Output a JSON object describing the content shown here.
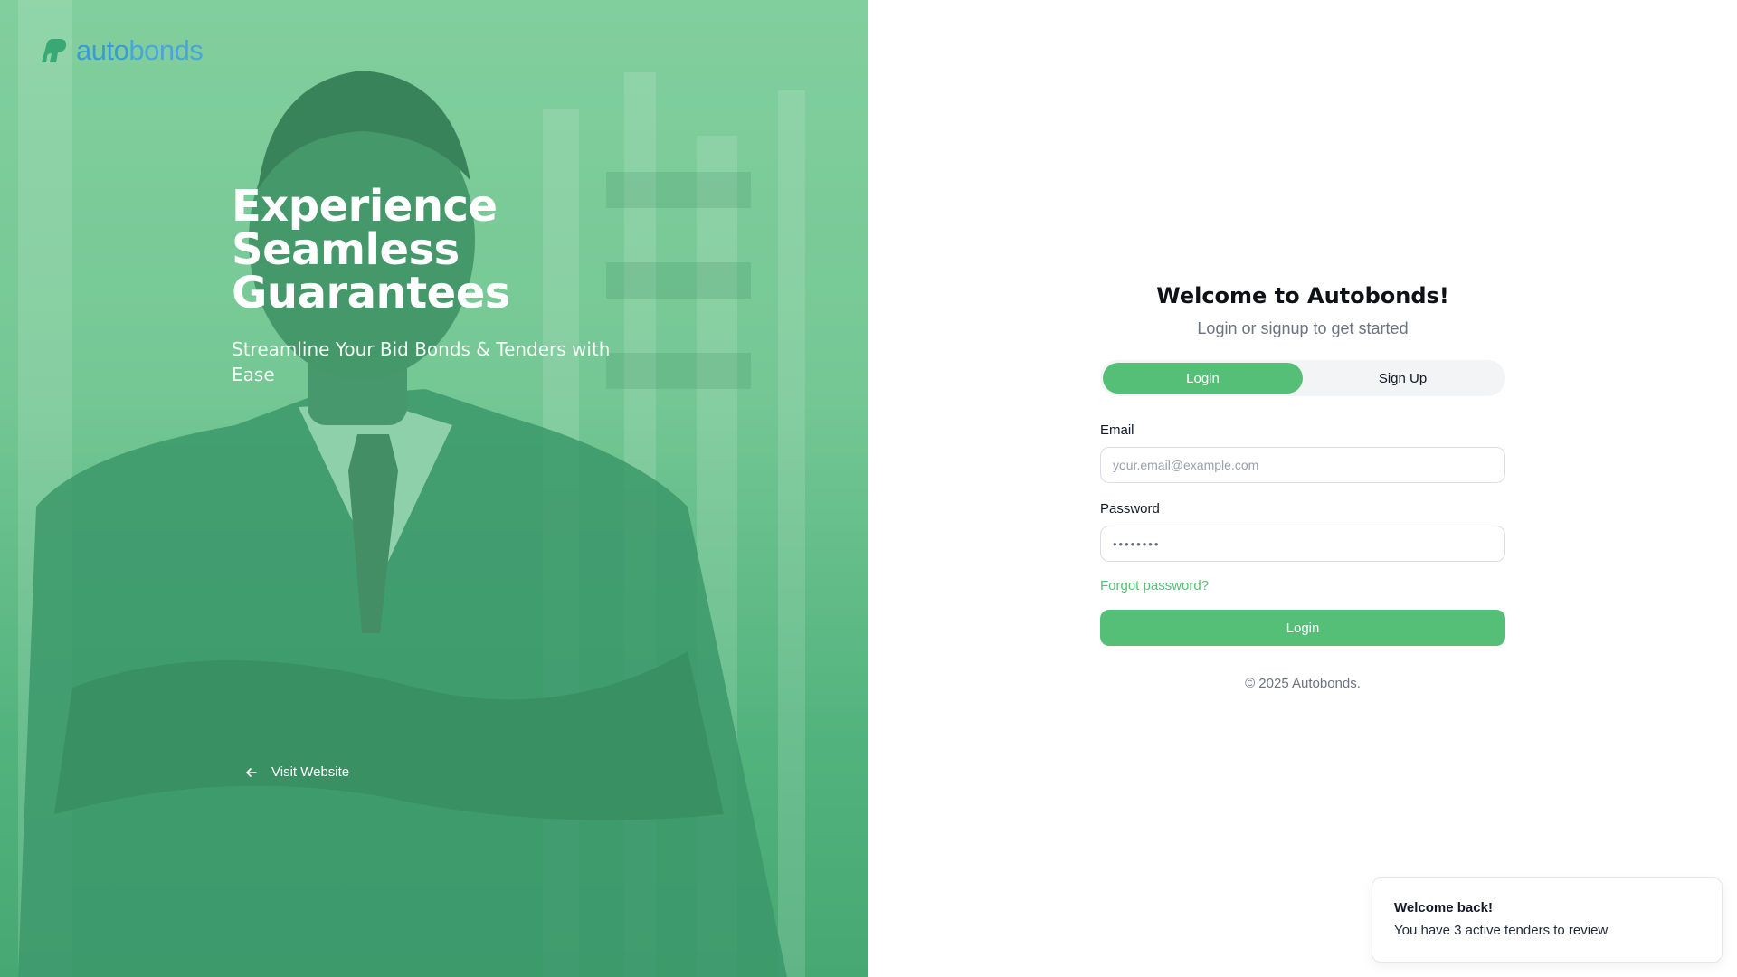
{
  "brand": {
    "logo_text_auto": "auto",
    "logo_text_bonds": "bonds",
    "primary_color": "#55bf77",
    "logo_color": "#3a9bd6"
  },
  "hero": {
    "headline_line1": "Experience",
    "headline_line2": "Seamless",
    "headline_line3": "Guarantees",
    "subheadline": "Streamline Your Bid Bonds & Tenders with Ease",
    "visit_link": "Visit Website",
    "visit_icon": "arrow-left-icon"
  },
  "login": {
    "title": "Welcome to Autobonds!",
    "subtitle": "Login or signup to get started",
    "tabs": [
      {
        "label": "Login",
        "active": true
      },
      {
        "label": "Sign Up",
        "active": false
      }
    ],
    "email_label": "Email",
    "email_placeholder": "your.email@example.com",
    "password_label": "Password",
    "password_value": "••••••••",
    "forgot_link": "Forgot password?",
    "submit_label": "Login",
    "copyright": "© 2025 Autobonds."
  },
  "toast": {
    "title": "Welcome back!",
    "message": "You have 3 active tenders to review"
  }
}
